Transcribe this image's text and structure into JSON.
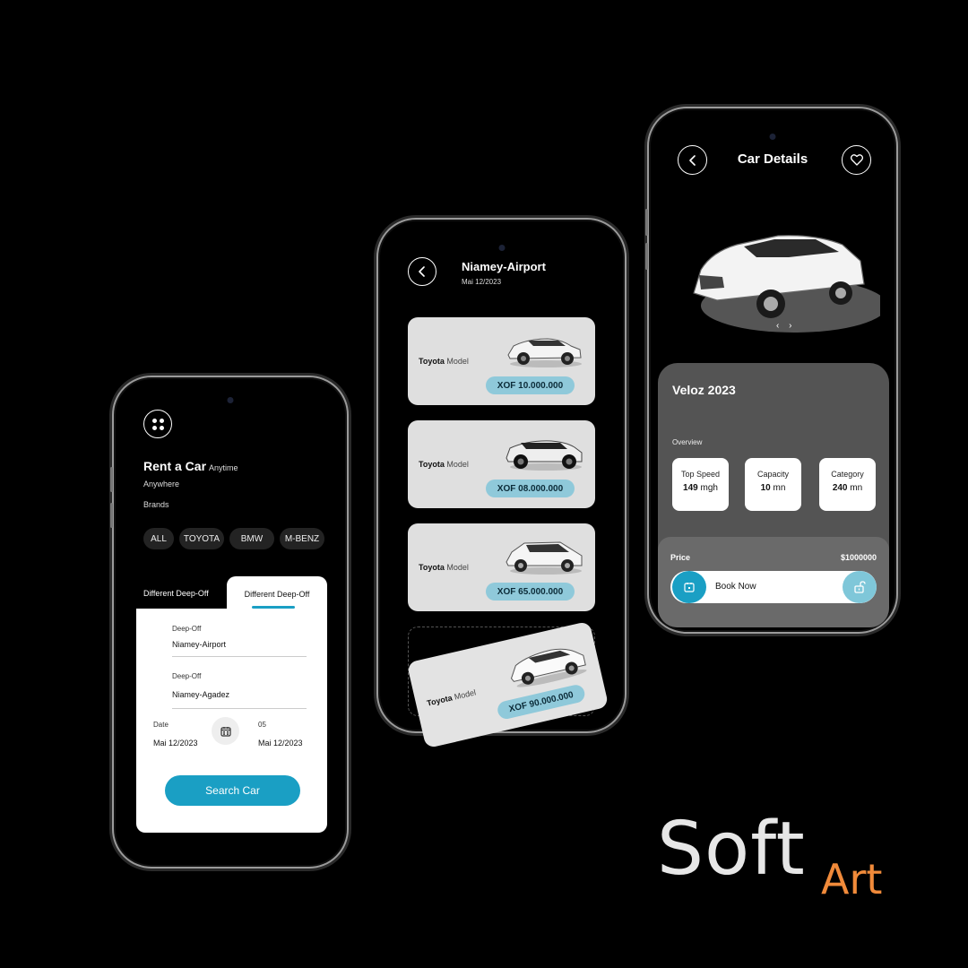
{
  "screen1": {
    "title": "Rent a Car",
    "title_suffix": "Anytime",
    "subtitle": "Anywhere",
    "brands_label": "Brands",
    "brands": [
      "ALL",
      "TOYOTA",
      "BMW",
      "M-BENZ"
    ],
    "tabs": [
      "Different Deep-Off",
      "Different Deep-Off"
    ],
    "fields": [
      {
        "label": "Deep-Off",
        "value": "Niamey-Airport"
      },
      {
        "label": "Deep-Off",
        "value": "Niamey-Agadez"
      }
    ],
    "date_left": {
      "label": "Date",
      "value": "Mai 12/2023"
    },
    "date_right": {
      "label": "05",
      "value": "Mai 12/2023"
    },
    "search_button": "Search Car"
  },
  "screen2": {
    "title": "Niamey-Airport",
    "date": "Mai 12/2023",
    "cars": [
      {
        "brand": "Toyota",
        "model": "Model",
        "price": "XOF 10.000.000"
      },
      {
        "brand": "Toyota",
        "model": "Model",
        "price": "XOF 08.000.000"
      },
      {
        "brand": "Toyota",
        "model": "Model",
        "price": "XOF 65.000.000"
      },
      {
        "brand": "Toyota",
        "model": "Model",
        "price": "XOF 90.000.000"
      }
    ]
  },
  "screen3": {
    "title": "Car Details",
    "car_name": "Veloz 2023",
    "overview_label": "Overview",
    "specs": [
      {
        "label": "Top Speed",
        "value": "149",
        "unit": "mgh"
      },
      {
        "label": "Capacity",
        "value": "10",
        "unit": "mn"
      },
      {
        "label": "Category",
        "value": "240",
        "unit": "mn"
      }
    ],
    "price_label": "Price",
    "price_value": "$1000000",
    "book_button": "Book Now"
  },
  "logo": {
    "word1": "Soft",
    "word2": "Art"
  },
  "colors": {
    "accent": "#1a9fc4",
    "pill": "#8fc9da",
    "logo_orange": "#f08a3a"
  },
  "icons": [
    "menu-dots-icon",
    "chevron-left-icon",
    "heart-icon",
    "calendar-icon",
    "unlock-icon"
  ]
}
